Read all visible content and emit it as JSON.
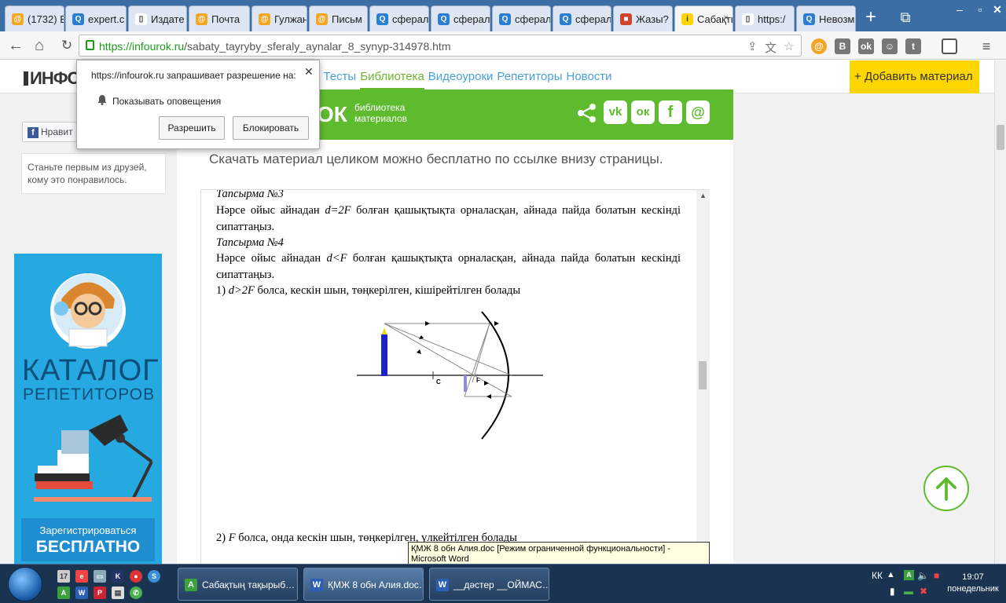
{
  "browser": {
    "tabs": [
      {
        "title": "(1732) В",
        "icon_color": "#f5a623",
        "icon": "@"
      },
      {
        "title": "expert.с",
        "icon_color": "#2a7fd4",
        "icon": "Q"
      },
      {
        "title": "Издате",
        "icon_color": "#ffffff",
        "icon": "▯"
      },
      {
        "title": "Почта",
        "icon_color": "#f5a623",
        "icon": "@"
      },
      {
        "title": "Гулжан",
        "icon_color": "#f5a623",
        "icon": "@"
      },
      {
        "title": "Письм",
        "icon_color": "#f5a623",
        "icon": "@"
      },
      {
        "title": "сферал",
        "icon_color": "#2a7fd4",
        "icon": "Q"
      },
      {
        "title": "сферал",
        "icon_color": "#2a7fd4",
        "icon": "Q"
      },
      {
        "title": "сферал",
        "icon_color": "#2a7fd4",
        "icon": "Q"
      },
      {
        "title": "сферал",
        "icon_color": "#2a7fd4",
        "icon": "Q"
      },
      {
        "title": "Жазы?",
        "icon_color": "#d0442c",
        "icon": "■"
      },
      {
        "title": "Сабақты",
        "icon_color": "#ffd600",
        "icon": "i"
      },
      {
        "title": "https:/",
        "icon_color": "#ffffff",
        "icon": "▯"
      },
      {
        "title": "Невозм",
        "icon_color": "#2a7fd4",
        "icon": "Q"
      }
    ],
    "active_tab_index": 11,
    "url_host": "https://infourok.ru",
    "url_path": "/sabaty_tayryby_sferaly_aynalar_8_synyp-314978.htm"
  },
  "site": {
    "logo": "ИНФО",
    "nav": [
      "и",
      "Тесты",
      "Библиотека",
      "Видеоуроки",
      "Репетиторы",
      "Новости"
    ],
    "nav_active": "Библиотека",
    "add_button": "Добавить материал",
    "add_button_plus": "+"
  },
  "sidebar": {
    "fb_like": "Нравит",
    "like_text": "Станьте первым из друзей, кому это понравилось.",
    "promo": {
      "title1": "КАТАЛОГ",
      "title2": "РЕПЕТИТОРОВ",
      "btn_line1": "Зарегистрироваться",
      "btn_line2": "БЕСПЛАТНО"
    }
  },
  "banner": {
    "brand": "ОК",
    "sub1": "библиотека",
    "sub2": "материалов",
    "icons": [
      "share-icon",
      "vk-icon",
      "ok-icon",
      "facebook-icon",
      "mail-icon"
    ],
    "icon_glyphs": [
      "",
      "vk",
      "ок",
      "f",
      "@"
    ]
  },
  "main": {
    "download_msg": "Скачать материал целиком можно бесплатно по ссылке внизу страницы."
  },
  "document": {
    "task3_title": "Тапсырма №3",
    "task3_text_a": "Нәрсе ойыс айнадан ",
    "task3_math": "d=2F",
    "task3_text_b": " болған қашықтықта орналасқан, айнада пайда болатын кескінді сипаттаңыз.",
    "task4_title": "Тапсырма №4",
    "task4_text_a": "Нәрсе ойыс айнадан ",
    "task4_math": "d<F",
    "task4_text_b": " болған қашықтықта орналасқан, айнада пайда болатын кескінді сипаттаңыз.",
    "ans1_prefix": "1) ",
    "ans1_math": "d>2F",
    "ans1_text": " болса, кескін шын, төңкерілген, кішірейтілген болады",
    "ans2_prefix": "2) ",
    "ans2_math": "F",
    "ans2_text": " болса, онда кескін шын, төңкерілген, үлкейтілген болады",
    "diagram_label_c": "C",
    "diagram_label_f": "F"
  },
  "popup": {
    "title": "https://infourok.ru запрашивает разрешение на:",
    "notify": "Показывать оповещения",
    "allow": "Разрешить",
    "block": "Блокировать"
  },
  "tooltip": "ҚМЖ 8 обн Алия.doc [Режим ограниченной функциональности] - Microsoft Word",
  "taskbar": {
    "buttons": [
      {
        "label": "Сабақтың тақырыб…",
        "icon": "A",
        "icon_color": "#3ca03c"
      },
      {
        "label": "ҚМЖ 8 обн Алия.doc…",
        "icon": "W",
        "icon_color": "#2b5fb3"
      },
      {
        "label": "__дәстер __ОЙМАС…",
        "icon": "W",
        "icon_color": "#2b5fb3"
      }
    ],
    "lang": "КК",
    "time": "19:07",
    "day": "понедельник"
  }
}
